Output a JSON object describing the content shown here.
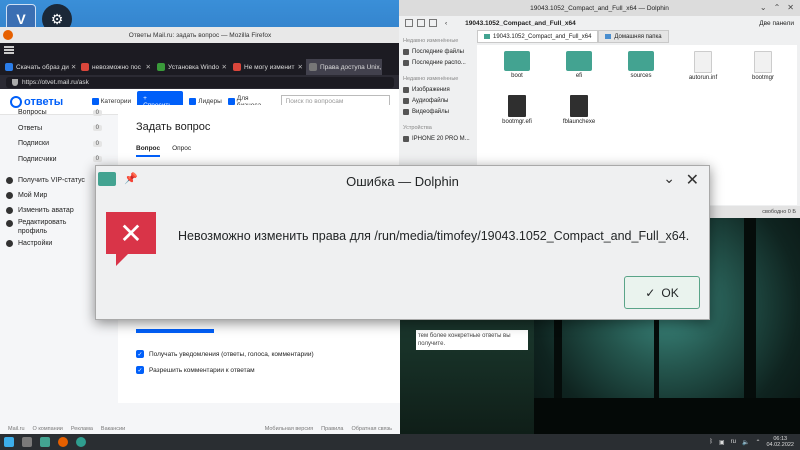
{
  "firefox": {
    "window_title": "Ответы Mail.ru: задать вопрос — Mozilla Firefox",
    "tabs": [
      {
        "label": "Скачать образ ди",
        "color": "#2b7de9"
      },
      {
        "label": "невозможно пос",
        "color": "#d9463b"
      },
      {
        "label": "Установка Windo",
        "color": "#3a9a3a"
      },
      {
        "label": "Не могу изменит",
        "color": "#d9463b"
      },
      {
        "label": "Права доступа Unix,",
        "color": "#777777"
      }
    ],
    "url": "https://otvet.mail.ru/ask"
  },
  "otvety": {
    "logo": "ответы",
    "logo_sub": "проект",
    "nav": {
      "categories": "Категории",
      "ask": "Спросить",
      "leaders": "Лидеры",
      "business": "Для бизнеса"
    },
    "search_placeholder": "Поиск по вопросам",
    "sidebar": {
      "questions": "Вопросы",
      "questions_count": "0",
      "answers": "Ответы",
      "answers_count": "0",
      "subscriptions": "Подписки",
      "subscriptions_count": "0",
      "subscribers": "Подписчики",
      "subscribers_count": "0",
      "vip": "Получить VIP-статус",
      "my_world": "Мой Мир",
      "change_avatar": "Изменить аватар",
      "edit_profile": "Редактировать профиль",
      "settings": "Настройки"
    },
    "main": {
      "title": "Задать вопрос",
      "tab_question": "Вопрос",
      "tab_poll": "Опрос",
      "notify_label": "Получать уведомления (ответы, голоса, комментарии)",
      "comments_label": "Разрешить комментарии к ответам",
      "help_text": "тем более конкретные ответы вы получите."
    },
    "footer": {
      "mailru": "Mail.ru",
      "about": "О компании",
      "ads": "Реклама",
      "jobs": "Вакансии",
      "mobile": "Мобильная версия",
      "rules": "Правила",
      "feedback": "Обратная связь"
    }
  },
  "dolphin": {
    "window_title": "19043.1052_Compact_and_Full_x64 — Dolphin",
    "breadcrumb": "19043.1052_Compact_and_Full_x64",
    "split": "Две панели",
    "places_header_recent": "Недавно изменённые",
    "places": [
      "Последние файлы",
      "Последние распо...",
      "Недавно изменённые",
      "Изображения",
      "Аудиофайлы",
      "Видеофайлы"
    ],
    "devices_header": "Устройства",
    "device": "IPHONE 20 PRO M...",
    "tab1": "19043.1052_Compact_and_Full_x64",
    "tab2": "Домашняя папка",
    "files": [
      "boot",
      "efi",
      "sources",
      "autorun.inf",
      "bootmgr",
      "bootmgr.efi",
      "fblaunchexe"
    ],
    "status": "свободно 0 Б"
  },
  "dialog": {
    "title": "Ошибка — Dolphin",
    "message": "Невозможно изменить права для /run/media/timofey/19043.1052_Compact_and_Full_x64.",
    "ok_label": "OK"
  },
  "taskbar": {
    "lang": "ru",
    "time": "06:13",
    "date": "04.02.2022"
  },
  "colors": {
    "accent_blue": "#005ff9",
    "error_red": "#d93448",
    "folder_teal": "#43a391"
  }
}
